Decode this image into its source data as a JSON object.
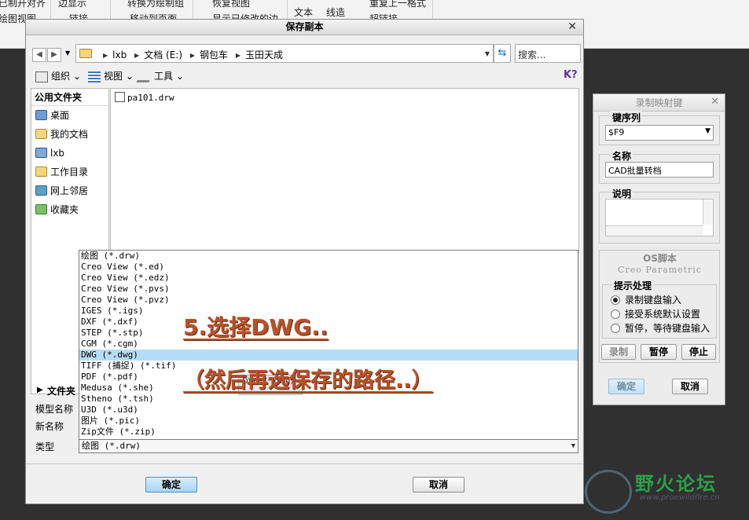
{
  "ribbon": {
    "row1": [
      "已制开对齐",
      "边显示",
      "转换为绘制组",
      "恢复视图",
      "文本",
      "线造",
      "重复上一格式"
    ],
    "row2": [
      "绘图视图",
      "链接",
      "移动到页面",
      "显示已修改的边",
      "超链接"
    ]
  },
  "dialog": {
    "title": "保存副本",
    "address": {
      "segments": [
        "lxb",
        "文档 (E:)",
        "钢包车",
        "玉田天成"
      ],
      "search_placeholder": "搜索..."
    },
    "toolbar": {
      "organize": "组织",
      "view": "视图",
      "tools": "工具"
    },
    "sidebar": {
      "header": "公用文件夹",
      "items": [
        {
          "label": "桌面",
          "icon": "desktop-icon"
        },
        {
          "label": "我的文档",
          "icon": "documents-icon"
        },
        {
          "label": "lxb",
          "icon": "computer-icon"
        },
        {
          "label": "工作目录",
          "icon": "working-dir-icon"
        },
        {
          "label": "网上邻居",
          "icon": "network-icon"
        },
        {
          "label": "收藏夹",
          "icon": "favorites-icon"
        }
      ]
    },
    "files": [
      {
        "name": "pa101.drw"
      }
    ],
    "lower": {
      "section": "文件夹",
      "model_name_label": "模型名称",
      "new_name_label": "新名称",
      "type_label": "类型"
    },
    "type_options": [
      "绘图 (*.drw)",
      "Creo View (*.ed)",
      "Creo View (*.edz)",
      "Creo View (*.pvs)",
      "Creo View (*.pvz)",
      "IGES (*.igs)",
      "DXF (*.dxf)",
      "STEP (*.stp)",
      "CGM (*.cgm)",
      "DWG (*.dwg)",
      "TIFF (捕捉) (*.tif)",
      "PDF (*.pdf)",
      "Medusa (*.she)",
      "Stheno (*.tsh)",
      "U3D (*.u3d)",
      "图片 (*.pic)",
      "Zip文件 (*.zip)"
    ],
    "selected_option_index": 9,
    "type_value": "绘图 (*.drw)",
    "tooltip": "DWG (*.dwg)",
    "ok_label": "确定",
    "cancel_label": "取消"
  },
  "annotations": {
    "line1": "5.选择DWG..",
    "line2": "（然后再选保存的路径..）"
  },
  "mapkey_panel": {
    "title": "录制映射键",
    "key_seq_label": "键序列",
    "key_seq_value": "$F9",
    "name_label": "名称",
    "name_value": "CAD批量转档",
    "desc_label": "说明",
    "os_script_label": "OS脚本",
    "creo_label": "Creo Parametric",
    "prompt_label": "提示处理",
    "radio_options": [
      {
        "label": "录制键盘输入",
        "checked": true
      },
      {
        "label": "接受系统默认设置",
        "checked": false
      },
      {
        "label": "暂停，等待键盘输入",
        "checked": false
      }
    ],
    "record_label": "录制",
    "pause_label": "暂停",
    "stop_label": "停止",
    "ok_label": "确定",
    "cancel_label": "取消"
  },
  "watermark": {
    "title": "野火论坛",
    "url": "www.proewildfire.cn"
  }
}
